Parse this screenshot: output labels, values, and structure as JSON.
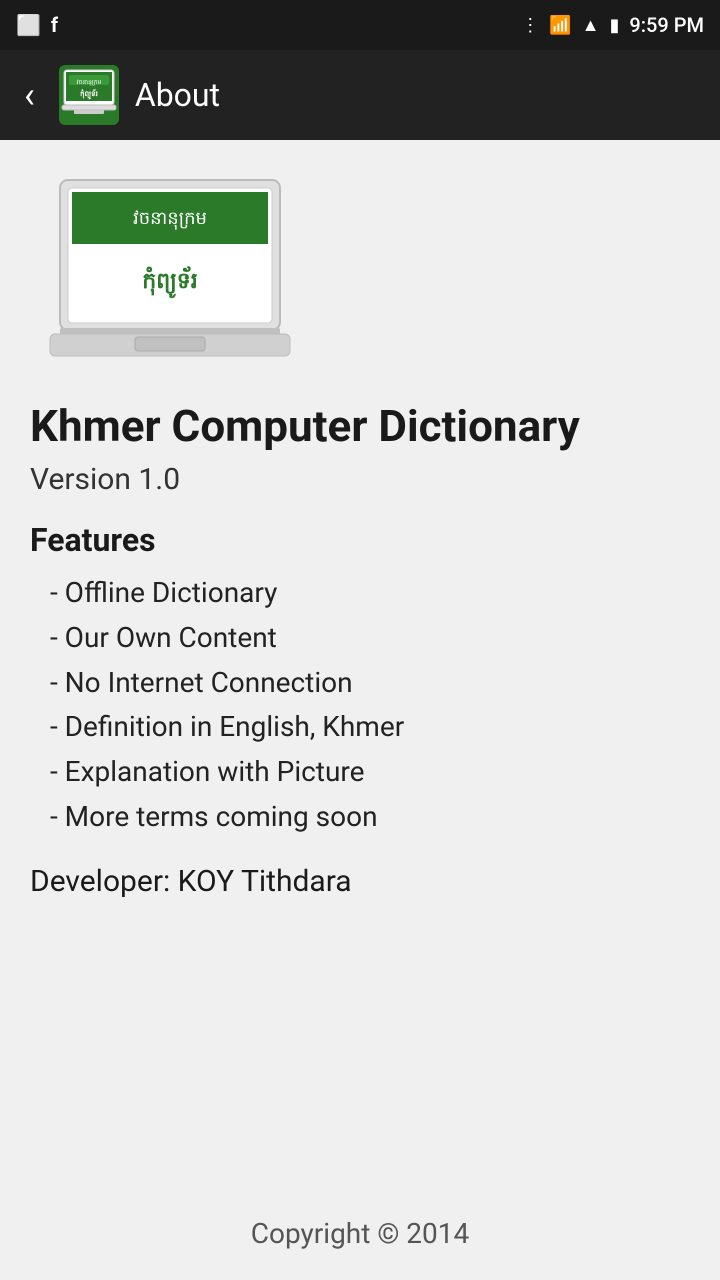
{
  "statusBar": {
    "time": "9:59 PM",
    "icons": [
      "bluetooth",
      "wifi",
      "signal",
      "battery"
    ]
  },
  "toolbar": {
    "backLabel": "‹",
    "title": "About"
  },
  "appLogo": {
    "line1": "វចនានុក្រម",
    "line2": "កុំព្យូទ័រ"
  },
  "main": {
    "appTitle": "Khmer Computer Dictionary",
    "version": "Version 1.0",
    "featuresTitle": "Features",
    "featuresList": [
      "- Offline Dictionary",
      "- Our Own Content",
      "- No Internet Connection",
      "- Definition in English, Khmer",
      "- Explanation with Picture",
      "- More terms coming soon"
    ],
    "developer": "Developer: KOY Tithdara"
  },
  "footer": {
    "copyright": "Copyright © 2014"
  }
}
